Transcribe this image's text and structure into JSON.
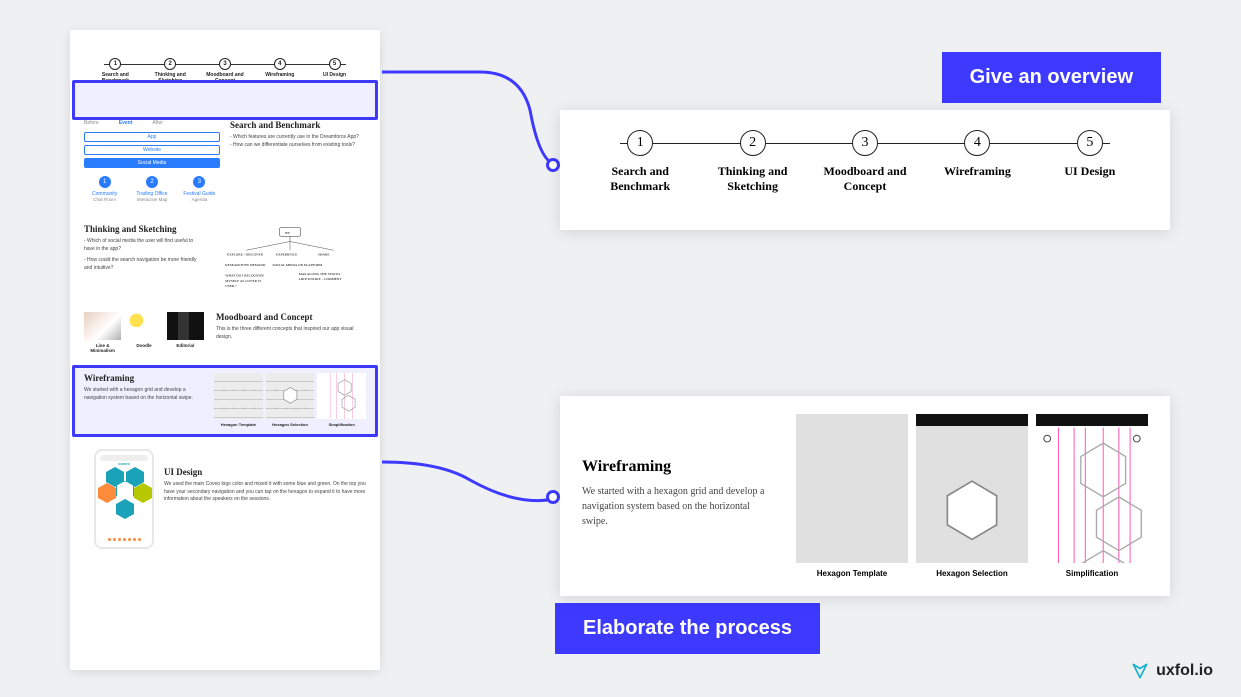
{
  "labels": {
    "overview": "Give an overview",
    "elaborate": "Elaborate the process"
  },
  "logo": {
    "text": "uxfol.io"
  },
  "steps": [
    {
      "num": "1",
      "label": "Search and Benchmark"
    },
    {
      "num": "2",
      "label": "Thinking and Sketching"
    },
    {
      "num": "3",
      "label": "Moodboard and Concept"
    },
    {
      "num": "4",
      "label": "Wireframing"
    },
    {
      "num": "5",
      "label": "UI Design"
    }
  ],
  "mock": {
    "tabs": [
      "Before",
      "Event",
      "After"
    ],
    "pills": [
      "App",
      "Website",
      "Social Media"
    ],
    "sec1": {
      "title": "Search and Benchmark",
      "body1": "- Which features are currently use in the Dreamforce App?",
      "body2": "- How can we differentiate ourselves from existing tools?",
      "chips": [
        {
          "num": "1",
          "t1": "Community",
          "t2": "Chat Room"
        },
        {
          "num": "2",
          "t1": "Trading Office",
          "t2": "Interactive Map"
        },
        {
          "num": "3",
          "t1": "Festival Guide",
          "t2": "Agenda"
        }
      ]
    },
    "sec2": {
      "title": "Thinking and Sketching",
      "body1": "- Which of social media the user will find useful to have in the app?",
      "body2": "- How could the search navigation be more friendly and intuitive?"
    },
    "sec3": {
      "title": "Moodboard and Concept",
      "body": "This is the three different concepts that inspired our app visual design.",
      "thumbs": [
        "Line & Minimalism",
        "Doodle",
        "Editorial"
      ]
    },
    "sec4": {
      "title": "Wireframing",
      "body": "We started with a hexagon grid and develop a navigation system based on the horizontal swipe.",
      "thumbs": [
        "Hexagon Template",
        "Hexagon Selection",
        "Simplification"
      ]
    },
    "sec5": {
      "title": "UI Design",
      "body": "We used the main Coveo logo color and mixed it with some blue and green. On the top you have your secondary navigation and you can tap on the hexagon to expand it to have more information about the speakers on the sessions.",
      "brand": "coveo"
    }
  },
  "card2": {
    "title": "Wireframing",
    "desc": "We started with a hexagon grid and develop a navigation system based on the horizontal swipe.",
    "caps": [
      "Hexagon Template",
      "Hexagon Selection",
      "Simplification"
    ]
  }
}
